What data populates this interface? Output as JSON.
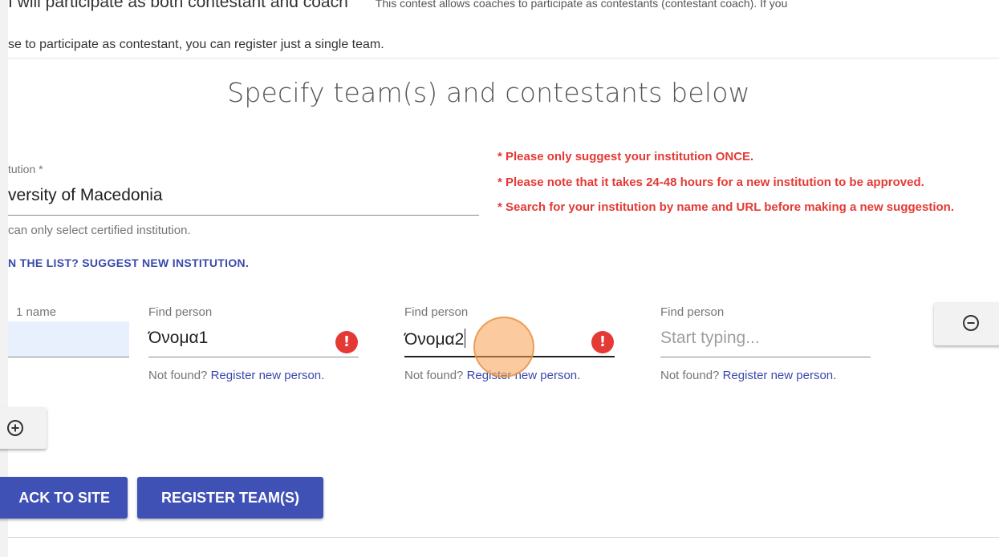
{
  "header": {
    "participation_option": "I will participate as both contestant and coach",
    "participation_note": "This contest allows coaches to participate as contestants (contestant coach). If you",
    "intro_continued": "se to participate as contestant, you can register just a single team."
  },
  "section": {
    "title": "Specify team(s) and contestants below"
  },
  "institution": {
    "label": "tution *",
    "value": "versity of Macedonia",
    "hint": "can only select certified institution.",
    "suggest_link": "N THE LIST? SUGGEST NEW INSTITUTION."
  },
  "warnings": [
    "* Please only suggest your institution ONCE.",
    "* Please note that it takes 24-48 hours for a new institution to be approved.",
    "* Search for your institution by name and URL before making a new suggestion."
  ],
  "team": {
    "label": "1 name",
    "value": ""
  },
  "persons": [
    {
      "label": "Find person",
      "value": "Όνομα1",
      "placeholder": "",
      "error": true,
      "hint_text": "Not found?",
      "hint_link": "Register new person."
    },
    {
      "label": "Find person",
      "value": "Όνομα2",
      "placeholder": "",
      "error": true,
      "hint_text": "Not found?",
      "hint_link": "Register new person."
    },
    {
      "label": "Find person",
      "value": "",
      "placeholder": "Start typing...",
      "error": false,
      "hint_text": "Not found?",
      "hint_link": "Register new person."
    }
  ],
  "buttons": {
    "back": "ACK TO SITE",
    "register": "REGISTER TEAM(S)"
  },
  "icons": {
    "error": "exclamation-circle-icon",
    "remove": "minus-circle-icon",
    "add": "plus-circle-icon"
  },
  "colors": {
    "primary": "#3f51b5",
    "link": "#3949ab",
    "error": "#e53935",
    "autofill": "#e8f0fe"
  }
}
